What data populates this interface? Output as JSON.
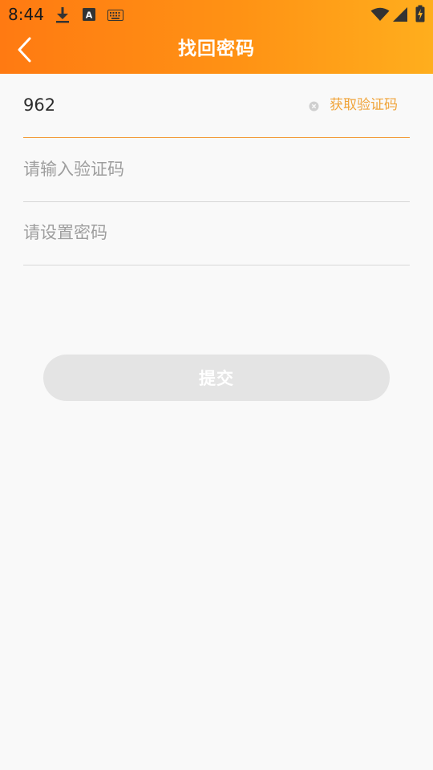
{
  "status_bar": {
    "time": "8:44",
    "icons": [
      "download-icon",
      "text-input-icon",
      "keyboard-icon",
      "wifi-icon",
      "signal-icon",
      "battery-charging-icon"
    ]
  },
  "header": {
    "title": "找回密码",
    "back_icon": "chevron-left-icon"
  },
  "form": {
    "phone": {
      "value": "962",
      "placeholder": "",
      "get_code_label": "获取验证码"
    },
    "code": {
      "value": "",
      "placeholder": "请输入验证码"
    },
    "password": {
      "value": "",
      "placeholder": "请设置密码"
    },
    "submit_label": "提交"
  },
  "colors": {
    "header_start": "#ff7a12",
    "header_end": "#ffae1d",
    "accent": "#f0a43a",
    "active_line": "#f39a3a",
    "button_disabled": "#e4e4e4",
    "background": "#f9f9f9"
  }
}
